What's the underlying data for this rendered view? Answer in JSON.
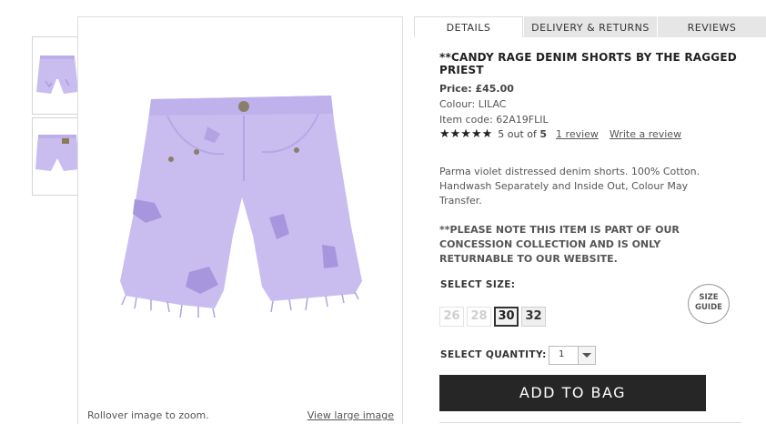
{
  "product_image": {
    "rollover_text": "Rollover image to zoom.",
    "view_large_label": "View large image"
  },
  "tabs": [
    {
      "label": "DETAILS",
      "active": true
    },
    {
      "label": "DELIVERY & RETURNS",
      "active": false
    },
    {
      "label": "REVIEWS",
      "active": false
    }
  ],
  "product": {
    "title": "**CANDY RAGE DENIM SHORTS BY THE RAGGED PRIEST",
    "price": "Price: £45.00",
    "colour": "Colour: LILAC",
    "item_code": "Item code: 62A19FLIL",
    "stars": "★★★★★",
    "rating_prefix": "5 out of",
    "rating_max": "5",
    "review_link": "1 review",
    "write_review_link": "Write a review",
    "description": "Parma violet distressed denim shorts. 100% Cotton. Handwash Separately and Inside Out, Colour May Transfer.",
    "notice": "**PLEASE NOTE THIS ITEM IS PART OF OUR CONCESSION COLLECTION AND IS ONLY RETURNABLE TO OUR WEBSITE."
  },
  "size": {
    "label": "SELECT SIZE:",
    "options": [
      {
        "label": "26",
        "state": "unavailable"
      },
      {
        "label": "28",
        "state": "unavailable"
      },
      {
        "label": "30",
        "state": "selected"
      },
      {
        "label": "32",
        "state": "available"
      }
    ],
    "guide_line1": "SIZE",
    "guide_line2": "GUIDE"
  },
  "quantity": {
    "label": "SELECT QUANTITY:",
    "value": "1"
  },
  "add_to_bag_label": "ADD TO BAG",
  "colors": {
    "shorts": "#c9bdf0",
    "button": "#262626"
  }
}
